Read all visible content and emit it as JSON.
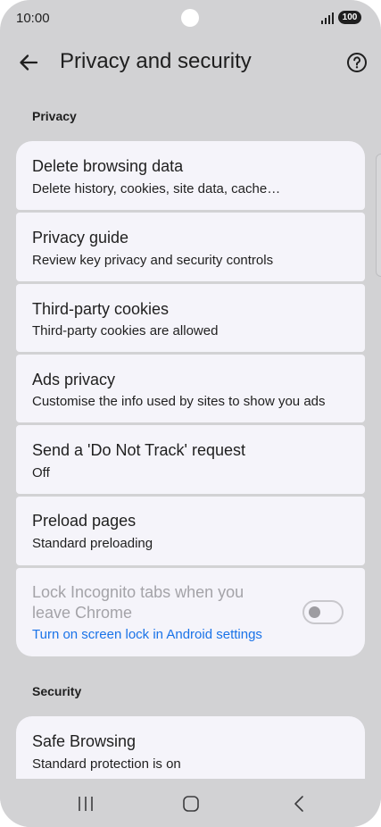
{
  "status_bar": {
    "time": "10:00",
    "battery": "100"
  },
  "app_bar": {
    "title": "Privacy and security"
  },
  "sections": {
    "privacy_header": "Privacy",
    "security_header": "Security"
  },
  "privacy_items": [
    {
      "title": "Delete browsing data",
      "subtitle": "Delete history, cookies, site data, cache…"
    },
    {
      "title": "Privacy guide",
      "subtitle": "Review key privacy and security controls"
    },
    {
      "title": "Third-party cookies",
      "subtitle": "Third-party cookies are allowed"
    },
    {
      "title": "Ads privacy",
      "subtitle": "Customise the info used by sites to show you ads"
    },
    {
      "title": "Send a 'Do Not Track' request",
      "subtitle": "Off"
    },
    {
      "title": "Preload pages",
      "subtitle": "Standard preloading"
    }
  ],
  "lock_incognito": {
    "title_line1": "Lock Incognito tabs when you",
    "title_line2": "leave Chrome",
    "link": "Turn on screen lock in Android settings",
    "toggle_on": false,
    "enabled": false
  },
  "security_items": [
    {
      "title": "Safe Browsing",
      "subtitle": "Standard protection is on"
    }
  ],
  "colors": {
    "background": "#d2d2d4",
    "card": "#f5f4fa",
    "text": "#1f1f1f",
    "disabled_text": "#a4a3a8",
    "link": "#1a73e8"
  },
  "icons": {
    "back": "arrow-left",
    "help": "question-circle",
    "nav_recents": "three-bars",
    "nav_home": "rounded-square",
    "nav_back": "chevron-left"
  }
}
